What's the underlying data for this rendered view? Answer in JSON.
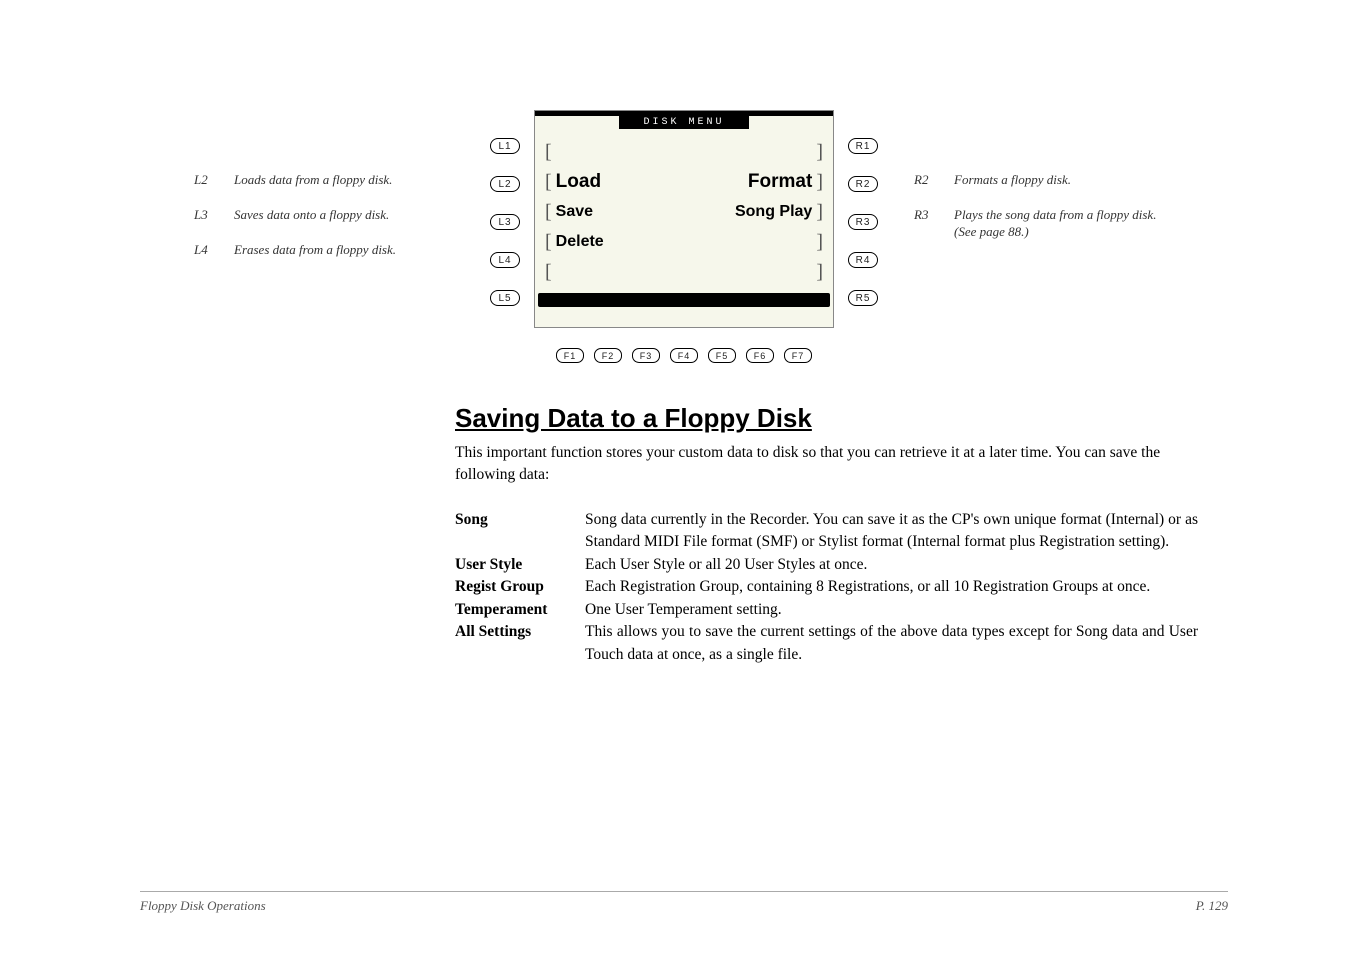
{
  "left_notes": [
    {
      "key": "L2",
      "text": "Loads data from a floppy disk."
    },
    {
      "key": "L3",
      "text": "Saves data onto a floppy disk."
    },
    {
      "key": "L4",
      "text": "Erases data from a floppy disk."
    }
  ],
  "right_notes": [
    {
      "key": "R2",
      "text": "Formats a floppy disk."
    },
    {
      "key": "R3",
      "text": "Plays the song data from a floppy disk. (See page 88.)"
    }
  ],
  "panel": {
    "title": "DISK MENU",
    "left_buttons": [
      "L1",
      "L2",
      "L3",
      "L4",
      "L5"
    ],
    "right_buttons": [
      "R1",
      "R2",
      "R3",
      "R4",
      "R5"
    ],
    "bottom_buttons": [
      "F1",
      "F2",
      "F3",
      "F4",
      "F5",
      "F6",
      "F7"
    ],
    "rows": [
      {
        "left": "",
        "right": ""
      },
      {
        "left": "Load",
        "right": "Format"
      },
      {
        "left": "Save",
        "right": "Song Play"
      },
      {
        "left": "Delete",
        "right": ""
      },
      {
        "left": "",
        "right": ""
      }
    ]
  },
  "section": {
    "heading": "Saving Data to a Floppy Disk",
    "intro": "This important function stores your custom data to disk so that you can retrieve it at a later time. You can save the following data:",
    "items": [
      {
        "term": "Song",
        "desc": "Song data currently in the Recorder.  You can save it as the CP's own unique format (Internal) or as Standard MIDI File format (SMF) or Stylist format (Internal format plus Registration setting)."
      },
      {
        "term": "User Style",
        "desc": "Each User Style or all 20 User Styles at once."
      },
      {
        "term": "Regist Group",
        "desc": "Each Registration Group, containing 8 Registrations, or all 10 Registration Groups at once."
      },
      {
        "term": "Temperament",
        "desc": "One User Temperament setting."
      },
      {
        "term": "All Settings",
        "desc": "This allows you to save the current settings of the above data types except for Song data and User Touch data at once, as a single file."
      }
    ]
  },
  "footer": {
    "left": "Floppy Disk Operations",
    "right": "P. 129"
  }
}
